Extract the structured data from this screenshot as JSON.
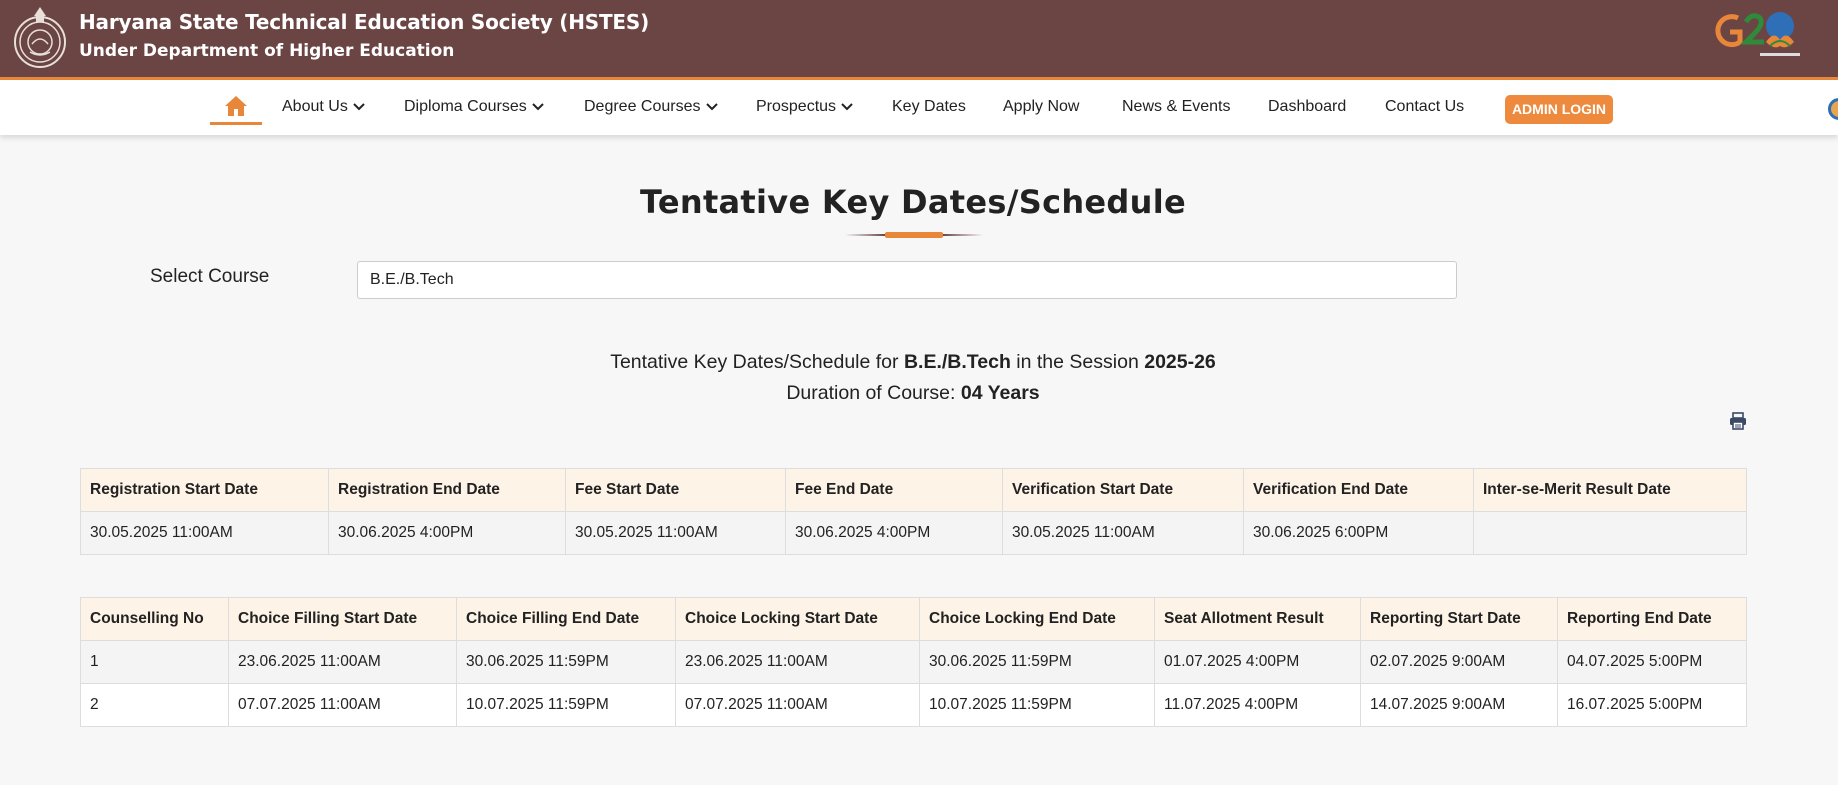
{
  "header": {
    "title": "Haryana State Technical Education Society (HSTES)",
    "subtitle": "Under Department of Higher Education",
    "logo_icon": "state-emblem-icon",
    "partner_logo_icon": "g20-logo-icon"
  },
  "nav": {
    "home_icon": "home-icon",
    "items": [
      {
        "label": "About Us",
        "dropdown": true
      },
      {
        "label": "Diploma Courses",
        "dropdown": true
      },
      {
        "label": "Degree Courses",
        "dropdown": true
      },
      {
        "label": "Prospectus",
        "dropdown": true
      },
      {
        "label": "Key Dates",
        "dropdown": false
      },
      {
        "label": "Apply Now",
        "dropdown": false
      },
      {
        "label": "News & Events",
        "dropdown": false
      },
      {
        "label": "Dashboard",
        "dropdown": false
      },
      {
        "label": "Contact Us",
        "dropdown": false
      }
    ],
    "admin_label": "ADMIN LOGIN"
  },
  "page": {
    "title": "Tentative Key Dates/Schedule",
    "select_label": "Select Course",
    "select_value": "B.E./B.Tech",
    "info_prefix": "Tentative Key Dates/Schedule for",
    "course": "B.E./B.Tech",
    "info_mid": "in the Session",
    "session": "2025-26",
    "duration_label": "Duration of Course:",
    "duration": "04 Years",
    "print_icon": "print-icon"
  },
  "table1": {
    "headers": [
      "Registration Start Date",
      "Registration End Date",
      "Fee Start Date",
      "Fee End Date",
      "Verification Start Date",
      "Verification End Date",
      "Inter-se-Merit Result Date"
    ],
    "rows": [
      [
        "30.05.2025 11:00AM",
        "30.06.2025 4:00PM",
        "30.05.2025 11:00AM",
        "30.06.2025 4:00PM",
        "30.05.2025 11:00AM",
        "30.06.2025 6:00PM",
        ""
      ]
    ]
  },
  "table2": {
    "headers": [
      "Counselling No",
      "Choice Filling Start Date",
      "Choice Filling End Date",
      "Choice Locking Start Date",
      "Choice Locking End Date",
      "Seat Allotment Result",
      "Reporting Start Date",
      "Reporting End Date"
    ],
    "rows": [
      [
        "1",
        "23.06.2025 11:00AM",
        "30.06.2025 11:59PM",
        "23.06.2025 11:00AM",
        "30.06.2025 11:59PM",
        "01.07.2025 4:00PM",
        "02.07.2025 9:00AM",
        "04.07.2025 5:00PM"
      ],
      [
        "2",
        "07.07.2025 11:00AM",
        "10.07.2025 11:59PM",
        "07.07.2025 11:00AM",
        "10.07.2025 11:59PM",
        "11.07.2025 4:00PM",
        "14.07.2025 9:00AM",
        "16.07.2025 5:00PM"
      ]
    ]
  },
  "colors": {
    "header_bg": "#6b4444",
    "accent": "#e8863a",
    "admin_btn": "#ee8a3e",
    "table_header_bg": "#fdf3e7"
  }
}
